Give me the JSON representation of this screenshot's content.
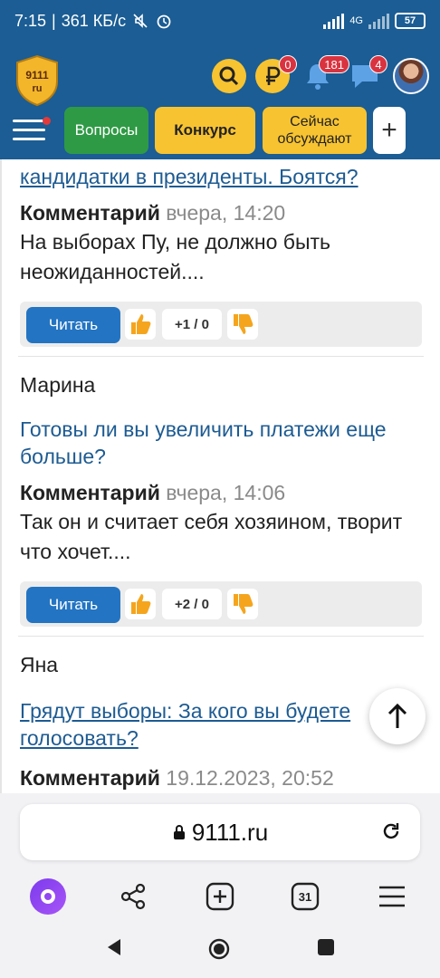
{
  "status_bar": {
    "time": "7:15",
    "speed": "361 КБ/с",
    "network": "4G",
    "battery": "57"
  },
  "header": {
    "logo_text_top": "9111",
    "logo_text_bottom": "ru",
    "balance_badge": "0",
    "notifications_badge": "181",
    "messages_badge": "4"
  },
  "menu": {
    "questions": "Вопросы",
    "contest": "Конкурс",
    "discussing_line1": "Сейчас",
    "discussing_line2": "обсуждают",
    "plus": "+"
  },
  "feed": [
    {
      "question_tail": "кандидатки в президенты. Боятся?",
      "comment_label": "Комментарий",
      "time": "вчера, 14:20",
      "text": "На выборах Пу, не должно быть неожиданностей....",
      "read": "Читать",
      "score": "+1 / 0"
    },
    {
      "author": "Марина",
      "question": "Готовы ли вы увеличить платежи еще больше?",
      "comment_label": "Комментарий",
      "time": "вчера, 14:06",
      "text": "Так он и считает себя хозяином, творит что хочет....",
      "read": "Читать",
      "score": "+2 / 0"
    },
    {
      "author": "Яна",
      "question": "Грядут выборы: За кого вы будете голосовать?",
      "comment_label": "Комментарий",
      "time": "19.12.2023, 20:52"
    }
  ],
  "browser": {
    "url": "9111.ru",
    "tabs_count": "31"
  }
}
